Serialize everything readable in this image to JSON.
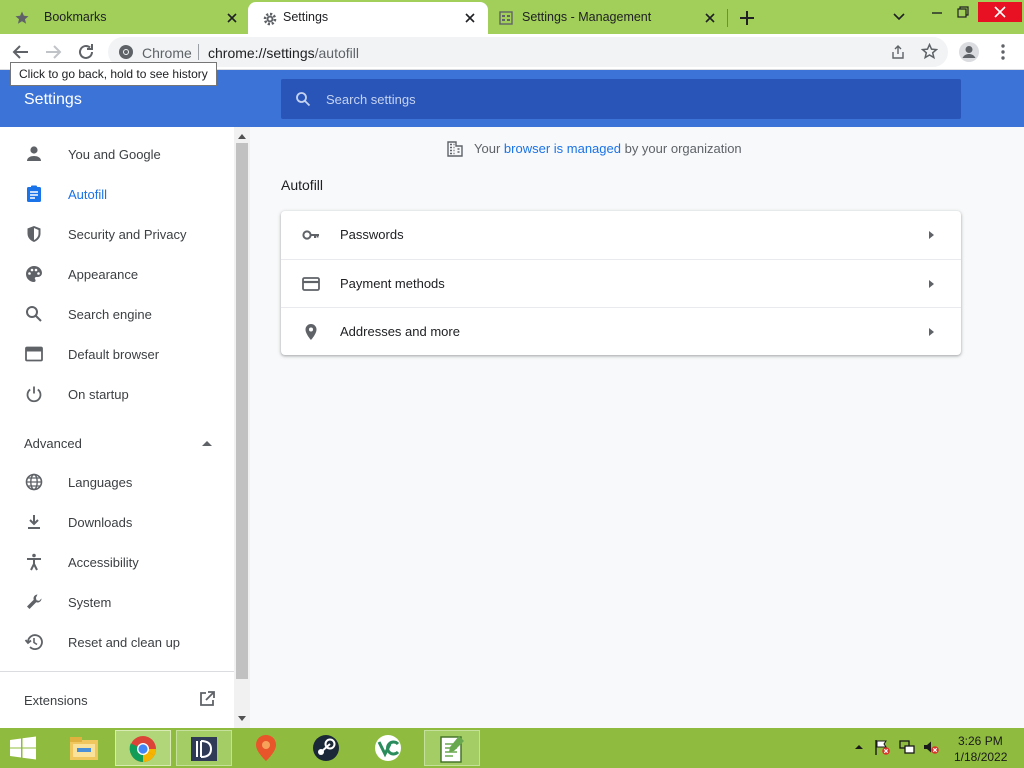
{
  "tabs": [
    {
      "title": "Bookmarks",
      "icon": "star-icon"
    },
    {
      "title": "Settings",
      "icon": "gear-icon"
    },
    {
      "title": "Settings - Management",
      "icon": "page-icon"
    }
  ],
  "toolbar": {
    "site_label": "Chrome",
    "url_host": "chrome://settings",
    "url_path": "/autofill",
    "back_tooltip": "Click to go back, hold to see history"
  },
  "settings": {
    "title": "Settings",
    "search_placeholder": "Search settings"
  },
  "sidebar": {
    "items": [
      {
        "label": "You and Google",
        "icon": "person-icon"
      },
      {
        "label": "Autofill",
        "icon": "assignment-icon",
        "active": true
      },
      {
        "label": "Security and Privacy",
        "icon": "shield-icon"
      },
      {
        "label": "Appearance",
        "icon": "palette-icon"
      },
      {
        "label": "Search engine",
        "icon": "search-icon"
      },
      {
        "label": "Default browser",
        "icon": "browser-icon"
      },
      {
        "label": "On startup",
        "icon": "power-icon"
      }
    ],
    "advanced_label": "Advanced",
    "advanced_items": [
      {
        "label": "Languages",
        "icon": "globe-icon"
      },
      {
        "label": "Downloads",
        "icon": "download-icon"
      },
      {
        "label": "Accessibility",
        "icon": "accessibility-icon"
      },
      {
        "label": "System",
        "icon": "wrench-icon"
      },
      {
        "label": "Reset and clean up",
        "icon": "restore-icon"
      }
    ],
    "extensions_label": "Extensions"
  },
  "main": {
    "managed_prefix": "Your",
    "managed_link": "browser is managed",
    "managed_suffix": "by your organization",
    "section_title": "Autofill",
    "rows": [
      {
        "label": "Passwords",
        "icon": "key-icon"
      },
      {
        "label": "Payment methods",
        "icon": "credit-card-icon"
      },
      {
        "label": "Addresses and more",
        "icon": "location-pin-icon"
      }
    ]
  },
  "taskbar": {
    "time": "3:26 PM",
    "date": "1/18/2022",
    "apps": [
      "file-explorer-icon",
      "chrome-icon",
      "app-icon",
      "marker-app-icon",
      "steam-icon",
      "vc-app-icon",
      "notepad-icon"
    ]
  },
  "colors": {
    "accent": "#1a73e8",
    "header": "#3b73d7",
    "titlebar": "#a2cf5a",
    "taskbar": "#8fbc3e"
  }
}
